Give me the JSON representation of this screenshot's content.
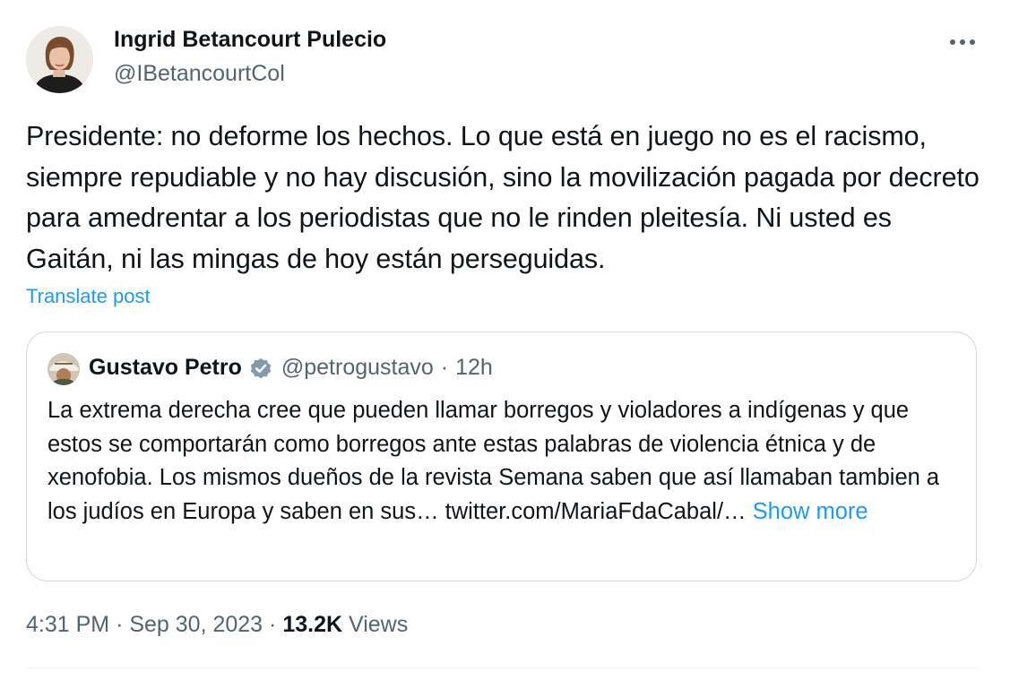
{
  "author": {
    "name": "Ingrid Betancourt Pulecio",
    "handle": "@IBetancourtCol"
  },
  "post": {
    "text": "Presidente: no deforme los hechos. Lo que está en juego no es el racismo, siempre repudiable y no hay discusión, sino la movilización pagada por decreto para amedrentar a los periodistas que no le rinden pleitesía. Ni usted es Gaitán, ni las mingas de hoy están perseguidas.",
    "translate_label": "Translate post"
  },
  "quoted": {
    "name": "Gustavo Petro",
    "handle": "@petrogustavo",
    "separator": "·",
    "time": "12h",
    "text": "La extrema derecha cree que pueden llamar borregos y violadores a indígenas y que estos se comportarán como borregos ante estas palabras de violencia étnica y de xenofobia. Los mismos dueños de la revista Semana saben que así llamaban tambien a los judíos en Europa y saben en sus… twitter.com/MariaFdaCabal/…",
    "show_more_label": "Show more"
  },
  "meta": {
    "time": "4:31 PM",
    "date": "Sep 30, 2023",
    "separator": "·",
    "views_count": "13.2K",
    "views_label": "Views"
  },
  "icons": {
    "more": "more-horizontal-icon",
    "verified": "verified-badge-icon"
  },
  "colors": {
    "text": "#0f1419",
    "secondary": "#536471",
    "link": "#1d9bf0",
    "border": "#cfd9de",
    "verified_badge": "#829aab"
  }
}
